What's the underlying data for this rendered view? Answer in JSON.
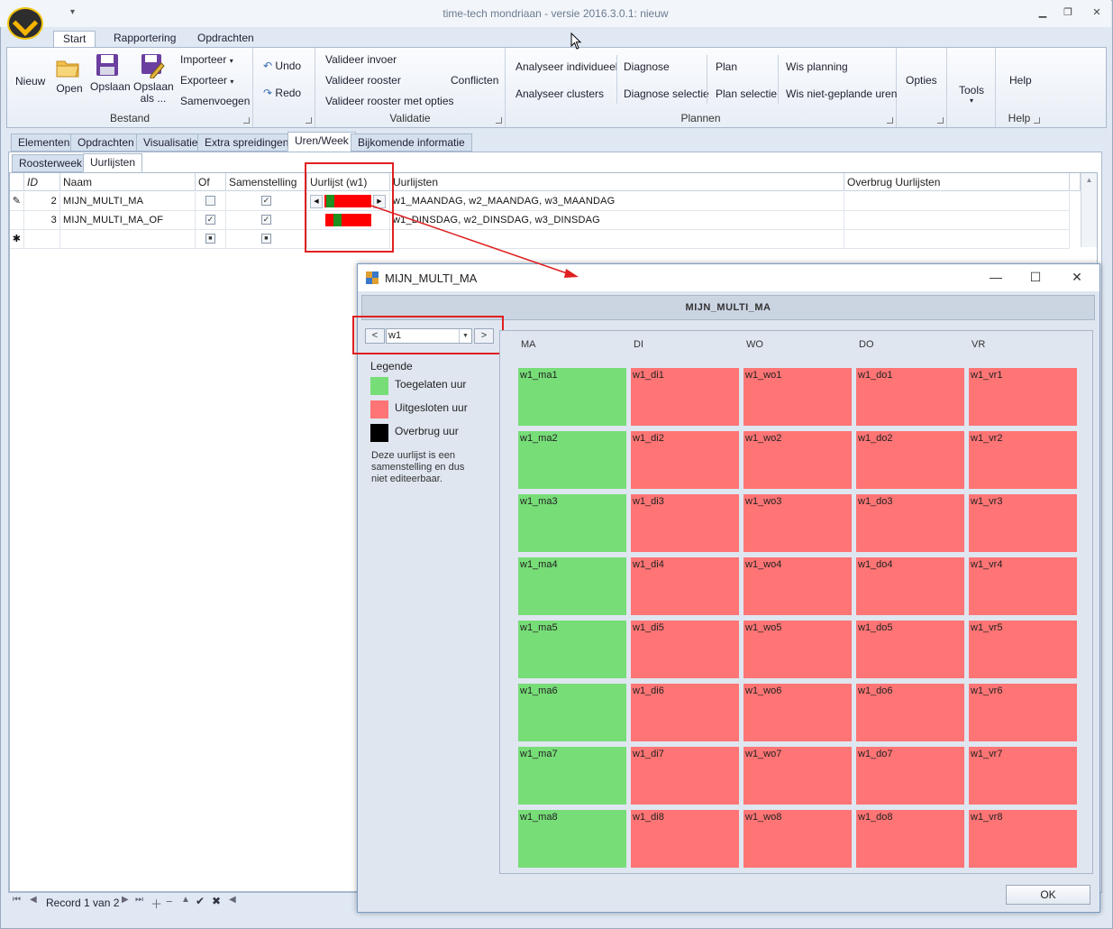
{
  "window": {
    "title": "time-tech mondriaan - versie 2016.3.0.1: nieuw"
  },
  "ribbon_tabs": [
    "Start",
    "Rapportering",
    "Opdrachten"
  ],
  "ribbon": {
    "bestand": {
      "label": "Bestand",
      "nieuw": "Nieuw",
      "open": "Open",
      "opslaan": "Opslaan",
      "opslaan_als_1": "Opslaan",
      "opslaan_als_2": "als ...",
      "importeer": "Importeer",
      "exporteer": "Exporteer",
      "samenvoegen": "Samenvoegen"
    },
    "undo": "Undo",
    "redo": "Redo",
    "validatie": {
      "label": "Validatie",
      "invoer": "Valideer invoer",
      "rooster": "Valideer rooster",
      "opties": "Valideer rooster met opties",
      "conflicten": "Conflicten"
    },
    "analyse": {
      "individueel": "Analyseer individueel",
      "clusters": "Analyseer clusters"
    },
    "plannen": {
      "label": "Plannen",
      "diagnose": "Diagnose",
      "diagnose_selectie": "Diagnose selectie",
      "plan": "Plan",
      "plan_selectie": "Plan selectie",
      "wis_planning": "Wis planning",
      "wis_uren": "Wis niet-geplande uren"
    },
    "opties": "Opties",
    "tools": "Tools",
    "help": "Help",
    "help_group": "Help"
  },
  "document_tabs": [
    "Elementen",
    "Opdrachten",
    "Visualisatie",
    "Extra spreidingen",
    "Uren/Week",
    "Bijkomende informatie"
  ],
  "sub_tabs": [
    "Roosterweek",
    "Uurlijsten"
  ],
  "grid": {
    "columns": [
      "ID",
      "Naam",
      "Of",
      "Samenstelling",
      "Uurlijst (w1)",
      "Uurlijsten",
      "Overbrug Uurlijsten"
    ],
    "rows": [
      {
        "id": "2",
        "naam": "MIJN_MULTI_MA",
        "of": false,
        "samenstelling": true,
        "uurlijsten": "w1_MAANDAG, w2_MAANDAG, w3_MAANDAG",
        "overbrug": ""
      },
      {
        "id": "3",
        "naam": "MIJN_MULTI_MA_OF",
        "of": true,
        "samenstelling": true,
        "uurlijsten": "w1_DINSDAG, w2_DINSDAG, w3_DINSDAG",
        "overbrug": ""
      }
    ]
  },
  "navigator": {
    "record_text": "Record 1 van 2"
  },
  "dialog": {
    "title": "MIJN_MULTI_MA",
    "header": "MIJN_MULTI_MA",
    "week": {
      "prev": "<",
      "value": "w1",
      "next": ">"
    },
    "legend": {
      "title": "Legende",
      "items": [
        {
          "label": "Toegelaten uur",
          "color": "#77dd77"
        },
        {
          "label": "Uitgesloten uur",
          "color": "#ff7474"
        },
        {
          "label": "Overbrug uur",
          "color": "#000000"
        }
      ],
      "note": "Deze uurlijst is een samenstelling en dus niet editeerbaar."
    },
    "days": [
      "MA",
      "DI",
      "WO",
      "DO",
      "VR"
    ],
    "slots": [
      [
        "w1_ma1",
        "w1_di1",
        "w1_wo1",
        "w1_do1",
        "w1_vr1"
      ],
      [
        "w1_ma2",
        "w1_di2",
        "w1_wo2",
        "w1_do2",
        "w1_vr2"
      ],
      [
        "w1_ma3",
        "w1_di3",
        "w1_wo3",
        "w1_do3",
        "w1_vr3"
      ],
      [
        "w1_ma4",
        "w1_di4",
        "w1_wo4",
        "w1_do4",
        "w1_vr4"
      ],
      [
        "w1_ma5",
        "w1_di5",
        "w1_wo5",
        "w1_do5",
        "w1_vr5"
      ],
      [
        "w1_ma6",
        "w1_di6",
        "w1_wo6",
        "w1_do6",
        "w1_vr6"
      ],
      [
        "w1_ma7",
        "w1_di7",
        "w1_wo7",
        "w1_do7",
        "w1_vr7"
      ],
      [
        "w1_ma8",
        "w1_di8",
        "w1_wo8",
        "w1_do8",
        "w1_vr8"
      ]
    ],
    "allowed_days": [
      "MA"
    ],
    "ok": "OK"
  }
}
